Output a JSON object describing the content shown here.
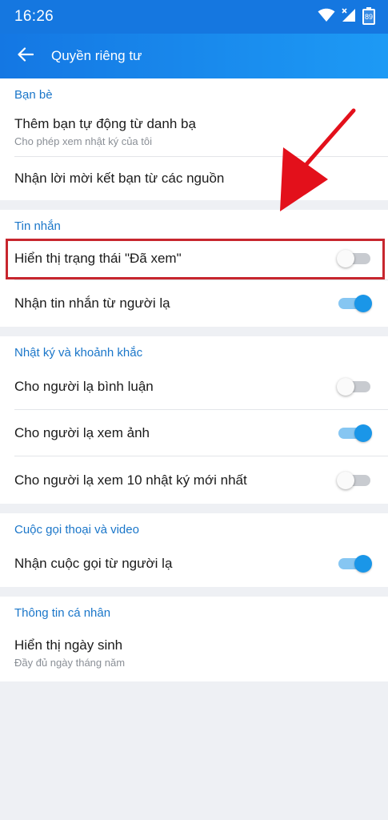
{
  "status_bar": {
    "time": "16:26",
    "battery_level": "89",
    "icons": [
      "wifi-icon",
      "cellular-signal-icon",
      "battery-icon"
    ]
  },
  "app_bar": {
    "title": "Quyền riêng tư",
    "back_icon": "arrow-left-icon"
  },
  "colors": {
    "app_bar": "#1a8cf0",
    "section_header": "#1a76c9",
    "toggle_on": "#1a96e8",
    "highlight": "#c7262e"
  },
  "sections": [
    {
      "header": "Bạn bè",
      "rows": [
        {
          "label": "Thêm bạn tự động từ danh bạ",
          "sub": "Cho phép xem nhật ký của tôi"
        },
        {
          "label": "Nhận lời mời kết bạn từ các nguồn"
        }
      ]
    },
    {
      "header": "Tin nhắn",
      "rows": [
        {
          "label": "Hiển thị trạng thái \"Đã xem\"",
          "toggle": false
        },
        {
          "label": "Nhận tin nhắn từ người lạ",
          "toggle": true
        }
      ]
    },
    {
      "header": "Nhật ký và khoảnh khắc",
      "rows": [
        {
          "label": "Cho người lạ bình luận",
          "toggle": false
        },
        {
          "label": "Cho người lạ xem ảnh",
          "toggle": true
        },
        {
          "label": "Cho người lạ xem 10 nhật ký mới nhất",
          "toggle": false
        }
      ]
    },
    {
      "header": "Cuộc gọi thoại và video",
      "rows": [
        {
          "label": "Nhận cuộc gọi từ người lạ",
          "toggle": true
        }
      ]
    },
    {
      "header": "Thông tin cá nhân",
      "rows": [
        {
          "label": "Hiển thị ngày sinh",
          "sub": "Đầy đủ ngày tháng năm"
        }
      ]
    }
  ]
}
